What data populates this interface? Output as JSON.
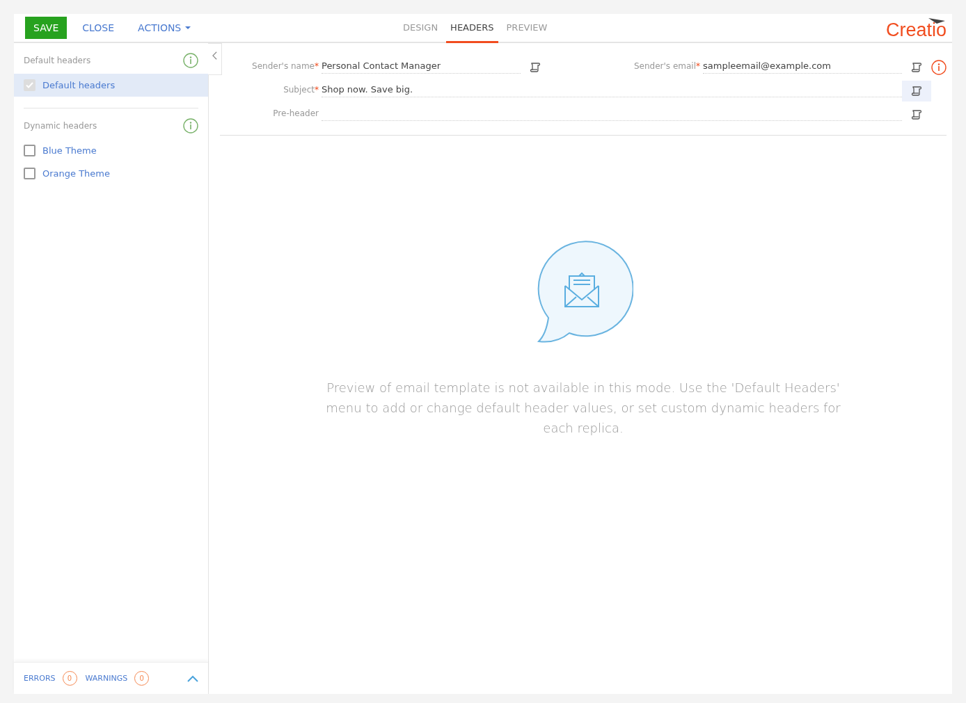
{
  "toolbar": {
    "buttons": [
      {
        "label": "SAVE",
        "kind": "primary"
      },
      {
        "label": "CLOSE",
        "kind": "link"
      },
      {
        "label": "ACTIONS",
        "kind": "menu"
      }
    ],
    "tabs": [
      {
        "label": "DESIGN",
        "selected": false
      },
      {
        "label": "HEADERS",
        "selected": true
      },
      {
        "label": "PREVIEW",
        "selected": false
      }
    ],
    "logo": "Creatio"
  },
  "sidebar": {
    "groups": [
      {
        "title": "Default headers",
        "items": [
          {
            "label": "Default headers",
            "checked": true,
            "disabled": true,
            "selected": true
          }
        ]
      },
      {
        "title": "Dynamic headers",
        "items": [
          {
            "label": "Blue Theme",
            "checked": false,
            "disabled": false,
            "selected": false
          },
          {
            "label": "Orange Theme",
            "checked": false,
            "disabled": false,
            "selected": false
          }
        ]
      }
    ],
    "status": [
      {
        "label": "ERRORS",
        "count": "0"
      },
      {
        "label": "WARNINGS",
        "count": "0"
      }
    ]
  },
  "header_fields": [
    [
      {
        "label": "Sender's name",
        "required_mark": "*",
        "value": "Personal Contact Manager",
        "highlighted": false
      },
      {
        "label": "Sender's email",
        "required_mark": "*",
        "value": "sampleemail@example.com",
        "highlighted": false,
        "warning": true
      }
    ],
    [
      {
        "label": "Subject",
        "required_mark": "*",
        "value": "Shop now. Save big.",
        "highlighted": true
      }
    ],
    [
      {
        "label": "Pre-header",
        "highlighted": false
      }
    ]
  ],
  "empty_message": "Preview of email template is not available in this mode. Use the 'Default Headers' menu to add or change default header values, or set custom dynamic headers for each replica."
}
